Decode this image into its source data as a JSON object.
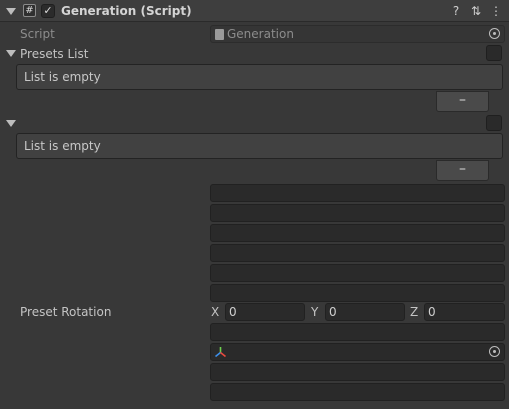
{
  "header": {
    "title": "Generation (Script)",
    "script_icon_glyph": "#",
    "enabled_check": "✓",
    "help_glyph": "?",
    "settings_glyph": "⇅",
    "menu_glyph": "⋮"
  },
  "script_field": {
    "label": "Script",
    "value": "Generation"
  },
  "presets_list": {
    "label": "Presets List",
    "empty_text": "List is empty",
    "remove_glyph": "–"
  },
  "second_list": {
    "label": "",
    "empty_text": "List is empty",
    "remove_glyph": "–"
  },
  "preset_rotation": {
    "label": "Preset Rotation",
    "x_label": "X",
    "x_value": "0",
    "y_label": "Y",
    "y_value": "0",
    "z_label": "Z",
    "z_value": "0"
  },
  "colors": {
    "background": "#383838",
    "field": "#2a2a2a",
    "text": "#c4c4c4"
  }
}
